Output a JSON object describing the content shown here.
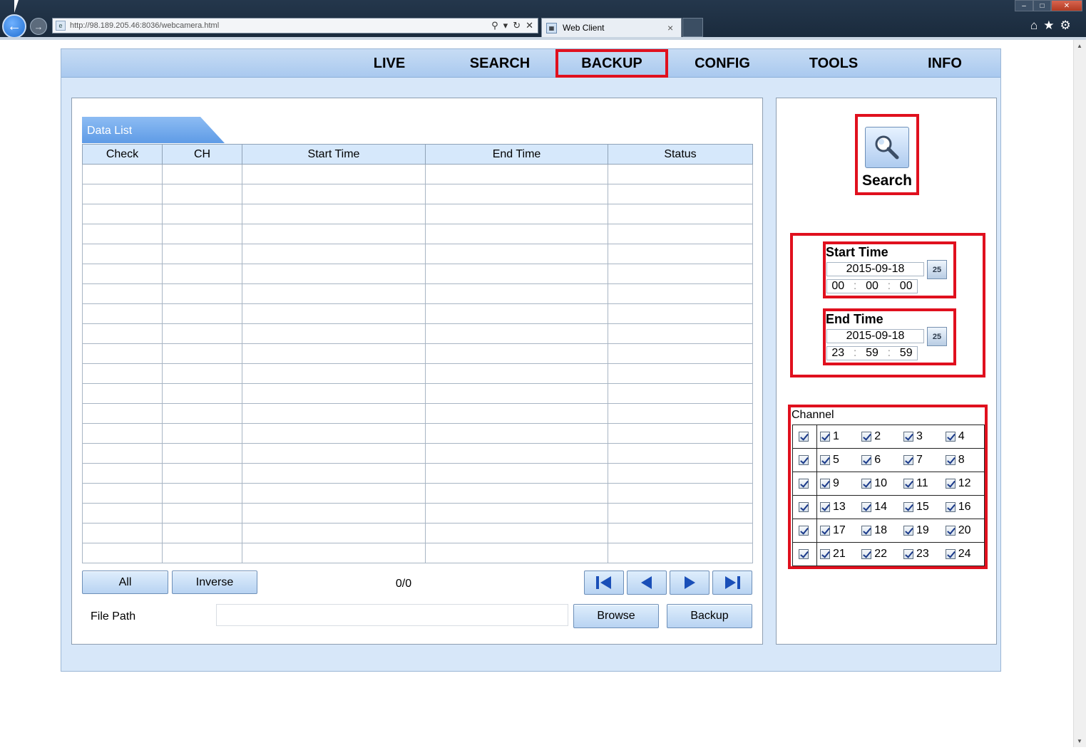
{
  "browser": {
    "url": "http://98.189.205.46:8036/webcamera.html",
    "tab_title": "Web Client",
    "tab_close": "×"
  },
  "menu": [
    {
      "label": "LIVE"
    },
    {
      "label": "SEARCH"
    },
    {
      "label": "BACKUP",
      "active": true
    },
    {
      "label": "CONFIG"
    },
    {
      "label": "TOOLS"
    },
    {
      "label": "INFO"
    }
  ],
  "data_list": {
    "tab_label": "Data List",
    "columns": [
      "Check",
      "CH",
      "Start Time",
      "End Time",
      "Status"
    ],
    "empty_rows": 20
  },
  "controls": {
    "all_label": "All",
    "inverse_label": "Inverse",
    "page_count": "0/0",
    "file_path_label": "File Path",
    "file_path_value": "",
    "browse_label": "Browse",
    "backup_label": "Backup"
  },
  "search": {
    "label": "Search"
  },
  "start_time": {
    "title": "Start Time",
    "date": "2015-09-18",
    "calendar_icon_text": "25",
    "hour": "00",
    "minute": "00",
    "second": "00"
  },
  "end_time": {
    "title": "End Time",
    "date": "2015-09-18",
    "calendar_icon_text": "25",
    "hour": "23",
    "minute": "59",
    "second": "59"
  },
  "channel": {
    "title": "Channel",
    "rows": [
      [
        "1",
        "2",
        "3",
        "4"
      ],
      [
        "5",
        "6",
        "7",
        "8"
      ],
      [
        "9",
        "10",
        "11",
        "12"
      ],
      [
        "13",
        "14",
        "15",
        "16"
      ],
      [
        "17",
        "18",
        "19",
        "20"
      ],
      [
        "21",
        "22",
        "23",
        "24"
      ]
    ],
    "all_checked": true
  },
  "colors": {
    "highlight": "#e0101e",
    "menubar": "#b6d1f2",
    "app_bg": "#d7e7f9",
    "tab_blue": "#6fa7ea"
  }
}
